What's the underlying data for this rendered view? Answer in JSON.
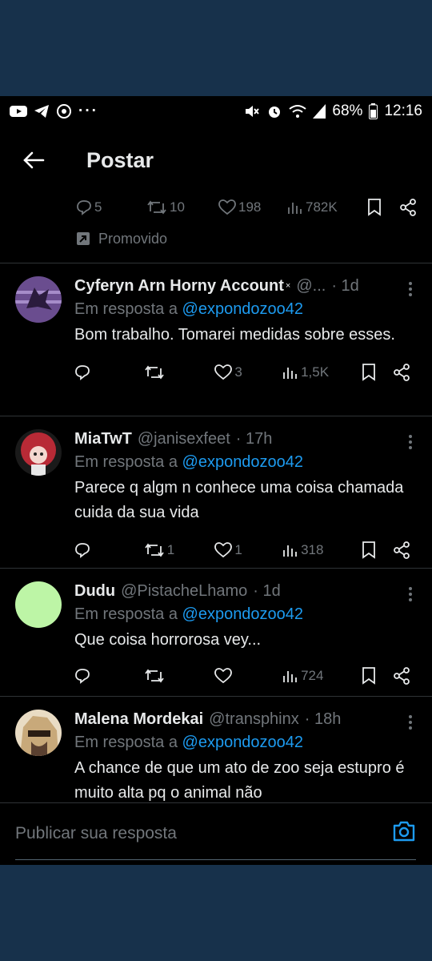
{
  "status_bar": {
    "battery": "68%",
    "time": "12:16",
    "left_icons": [
      "youtube-icon",
      "telegram-icon",
      "sync-icon",
      "more-dots-icon"
    ],
    "right_icons": [
      "mute-icon",
      "alarm-icon",
      "wifi-icon",
      "signal-icon",
      "battery-icon"
    ]
  },
  "header": {
    "title": "Postar"
  },
  "promoted_tweet": {
    "stats": {
      "replies": "5",
      "reposts": "10",
      "likes": "198",
      "views": "782K"
    },
    "promo_label": "Promovido"
  },
  "reply_prefix": "Em resposta a",
  "tweets": [
    {
      "name": "Cyferyn Arn Horny Account",
      "handle": "@...",
      "time": "· 1d",
      "mention": "@expondozoo42",
      "text": "Bom trabalho. Tomarei medidas sobre esses.",
      "stats": {
        "replies": "",
        "reposts": "",
        "likes": "3",
        "views": "1,5K"
      },
      "avatar_color": "#6a4d8f"
    },
    {
      "name": "MiaTwT",
      "handle": "@janisexfeet",
      "time": "· 17h",
      "mention": "@expondozoo42",
      "text": "Parece q algm n conhece uma coisa chamada cuida da sua vida",
      "stats": {
        "replies": "",
        "reposts": "1",
        "likes": "1",
        "views": "318"
      },
      "avatar_color": "#b82a36"
    },
    {
      "name": "Dudu",
      "handle": "@PistacheLhamo",
      "time": "· 1d",
      "mention": "@expondozoo42",
      "text": "Que coisa horrorosa vey...",
      "stats": {
        "replies": "",
        "reposts": "",
        "likes": "",
        "views": "724"
      },
      "avatar_color": "#bdf5a6"
    },
    {
      "name": "Malena Mordekai",
      "handle": "@transphinx",
      "time": "· 18h",
      "mention": "@expondozoo42",
      "text": "A chance de que um ato de zoo seja estupro é muito alta pq o animal não",
      "stats": {
        "replies": "",
        "reposts": "",
        "likes": "",
        "views": ""
      },
      "avatar_color": "#c8a97a"
    }
  ],
  "composer": {
    "placeholder": "Publicar sua resposta"
  },
  "colors": {
    "accent": "#1d9bf0",
    "muted": "#71767b",
    "background": "#000000",
    "divider": "#2f3336"
  }
}
